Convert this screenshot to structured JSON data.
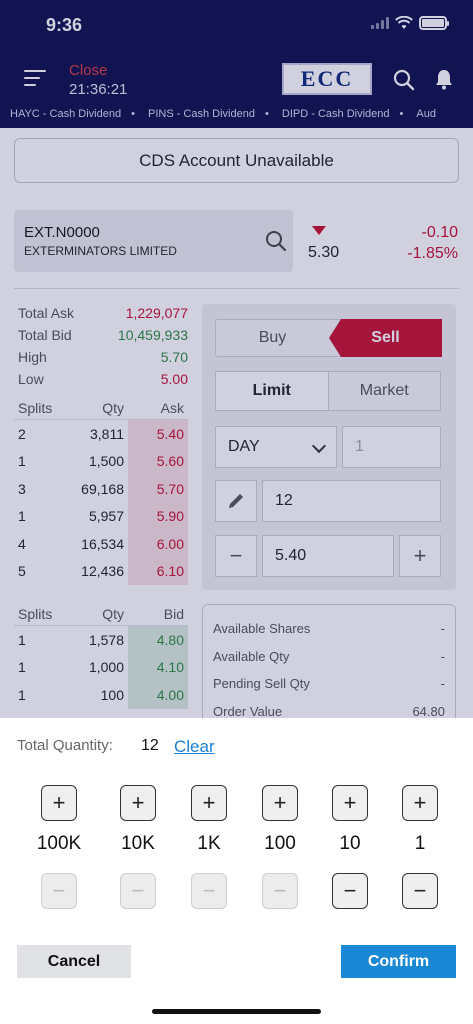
{
  "status_bar": {
    "time": "9:36"
  },
  "header": {
    "market_status": "Close",
    "market_time": "21:36:21",
    "logo_text": "ECC",
    "ticker": [
      "HAYC - Cash Dividend",
      "PINS - Cash Dividend",
      "DIPD - Cash Dividend",
      "Aud"
    ]
  },
  "cds_button": "CDS Account Unavailable",
  "symbol": {
    "code": "EXT.N0000",
    "name": "EXTERMINATORS LIMITED",
    "last_price": "5.30",
    "change": "-0.10",
    "change_pct": "-1.85%"
  },
  "stats": [
    {
      "label": "Total Ask",
      "value": "1,229,077",
      "color": "red"
    },
    {
      "label": "Total Bid",
      "value": "10,459,933",
      "color": "green"
    },
    {
      "label": "High",
      "value": "5.70",
      "color": "green"
    },
    {
      "label": "Low",
      "value": "5.00",
      "color": "red"
    }
  ],
  "ask_book": {
    "headers": [
      "Splits",
      "Qty",
      "Ask"
    ],
    "rows": [
      [
        "2",
        "3,811",
        "5.40"
      ],
      [
        "1",
        "1,500",
        "5.60"
      ],
      [
        "3",
        "69,168",
        "5.70"
      ],
      [
        "1",
        "5,957",
        "5.90"
      ],
      [
        "4",
        "16,534",
        "6.00"
      ],
      [
        "5",
        "12,436",
        "6.10"
      ]
    ]
  },
  "bid_book": {
    "headers": [
      "Splits",
      "Qty",
      "Bid"
    ],
    "rows": [
      [
        "1",
        "1,578",
        "4.80"
      ],
      [
        "1",
        "1,000",
        "4.10"
      ],
      [
        "1",
        "100",
        "4.00"
      ]
    ]
  },
  "order": {
    "buy_label": "Buy",
    "sell_label": "Sell",
    "limit_label": "Limit",
    "market_label": "Market",
    "validity": "DAY",
    "days_placeholder": "1",
    "quantity": "12",
    "price": "5.40"
  },
  "summary": [
    {
      "label": "Available Shares",
      "value": "-"
    },
    {
      "label": "Available Qty",
      "value": "-"
    },
    {
      "label": "Pending Sell Qty",
      "value": "-"
    },
    {
      "label": "Order Value",
      "value": "64.80"
    }
  ],
  "sheet": {
    "total_qty_label": "Total Quantity:",
    "total_qty_value": "12",
    "clear_label": "Clear",
    "steps": [
      {
        "label": "100K",
        "minus_enabled": false
      },
      {
        "label": "10K",
        "minus_enabled": false
      },
      {
        "label": "1K",
        "minus_enabled": false
      },
      {
        "label": "100",
        "minus_enabled": false
      },
      {
        "label": "10",
        "minus_enabled": true
      },
      {
        "label": "1",
        "minus_enabled": true
      }
    ],
    "plus_glyph": "+",
    "minus_glyph": "−",
    "cancel_label": "Cancel",
    "confirm_label": "Confirm"
  }
}
